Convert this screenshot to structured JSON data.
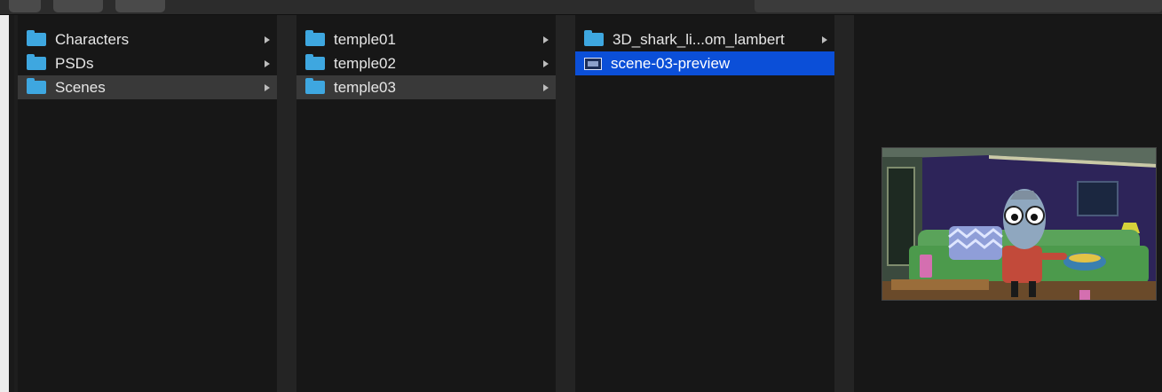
{
  "columns": [
    {
      "items": [
        {
          "label": "Characters",
          "icon": "folder-icon",
          "has_children": true,
          "selected": false
        },
        {
          "label": "PSDs",
          "icon": "folder-icon",
          "has_children": true,
          "selected": false
        },
        {
          "label": "Scenes",
          "icon": "folder-icon",
          "has_children": true,
          "selected": true
        }
      ]
    },
    {
      "items": [
        {
          "label": "temple01",
          "icon": "folder-icon",
          "has_children": true,
          "selected": false
        },
        {
          "label": "temple02",
          "icon": "folder-icon",
          "has_children": true,
          "selected": false
        },
        {
          "label": "temple03",
          "icon": "folder-icon",
          "has_children": true,
          "selected": true
        }
      ]
    },
    {
      "items": [
        {
          "label": "3D_shark_li...om_lambert",
          "icon": "folder-icon",
          "has_children": true,
          "selected": false
        },
        {
          "label": "scene-03-preview",
          "icon": "image-icon",
          "has_children": false,
          "selected": true
        }
      ]
    }
  ],
  "colors": {
    "folder": "#3ea7e0",
    "selection_active": "#0b4fd8",
    "selection_inactive": "#393939",
    "background": "#171717"
  }
}
